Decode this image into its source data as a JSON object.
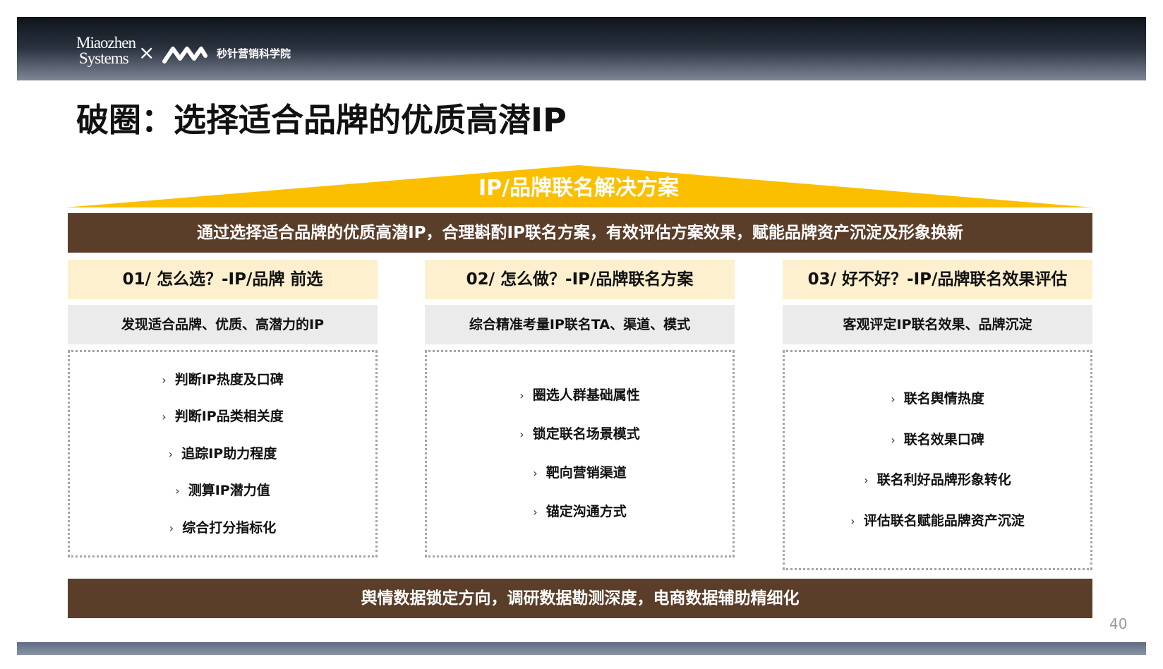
{
  "header": {
    "brand_name_line1": "Miaozhen",
    "brand_name_line2": "Systems",
    "separator": "×",
    "institute_name": "秒针营销科学院",
    "logo_icon": "miaozhen-wave-logo-icon"
  },
  "title": "破圈：选择适合品牌的优质高潜IP",
  "roof_label": "IP/品牌联名解决方案",
  "top_banner": "通过选择适合品牌的优质高潜IP，合理斟酌IP联名方案，有效评估方案效果，赋能品牌资产沉淀及形象换新",
  "columns": [
    {
      "heading": "01/  怎么选？-IP/品牌 前选",
      "subheading": "发现适合品牌、优质、高潜力的IP",
      "items": [
        "判断IP热度及口碑",
        "判断IP品类相关度",
        "追踪IP助力程度",
        "测算IP潜力值",
        "综合打分指标化"
      ]
    },
    {
      "heading": "02/  怎么做？-IP/品牌联名方案",
      "subheading": "综合精准考量IP联名TA、渠道、模式",
      "items": [
        "圈选人群基础属性",
        "锁定联名场景模式",
        "靶向营销渠道",
        "锚定沟通方式"
      ]
    },
    {
      "heading": "03/  好不好？-IP/品牌联名效果评估",
      "subheading": "客观评定IP联名效果、品牌沉淀",
      "items": [
        "联名舆情热度",
        "联名效果口碑",
        "联名利好品牌形象转化",
        "评估联名赋能品牌资产沉淀"
      ]
    }
  ],
  "item_arrow": "›",
  "bottom_banner": "舆情数据锁定方向，调研数据勘测深度，电商数据辅助精细化",
  "page_number": "40",
  "colors": {
    "header_dark": "#0f141b",
    "gold": "#fbbf00",
    "brown": "#5b3e2a",
    "cream": "#fdf0cf",
    "light_gray": "#ebebeb",
    "dotted_border": "#a5a5a5"
  }
}
